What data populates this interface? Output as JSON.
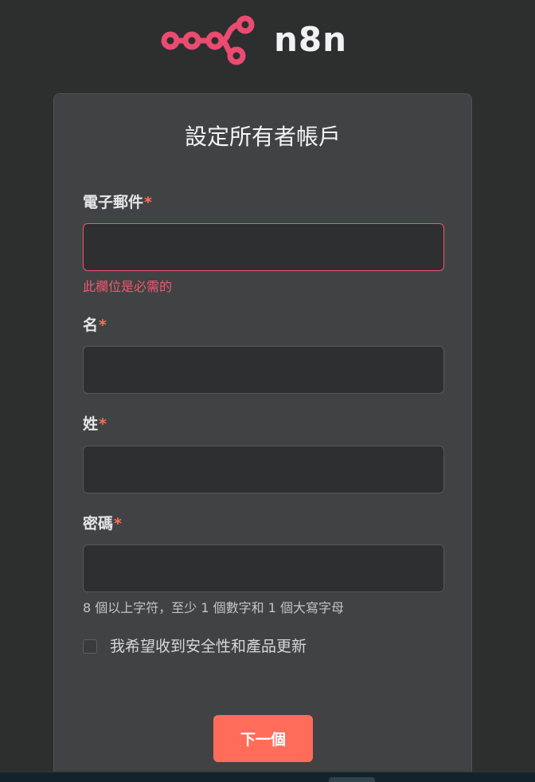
{
  "brand": {
    "name": "n8n",
    "logo_icon": "n8n-logo-icon",
    "logo_color": "#ea4b71"
  },
  "form": {
    "title": "設定所有者帳戶",
    "email": {
      "label": "電子郵件",
      "value": "",
      "error": "此欄位是必需的"
    },
    "first_name": {
      "label": "名",
      "value": ""
    },
    "last_name": {
      "label": "姓",
      "value": ""
    },
    "password": {
      "label": "密碼",
      "value": "",
      "hint": "8 個以上字符，至少 1 個數字和 1 個大寫字母"
    },
    "required_marker": "*",
    "subscribe": {
      "label": "我希望收到安全性和產品更新",
      "checked": false
    },
    "next_button": "下一個"
  },
  "colors": {
    "background": "#2d2e2e",
    "card": "#414244",
    "accent": "#ff6d5a",
    "error": "#ee5a70"
  }
}
